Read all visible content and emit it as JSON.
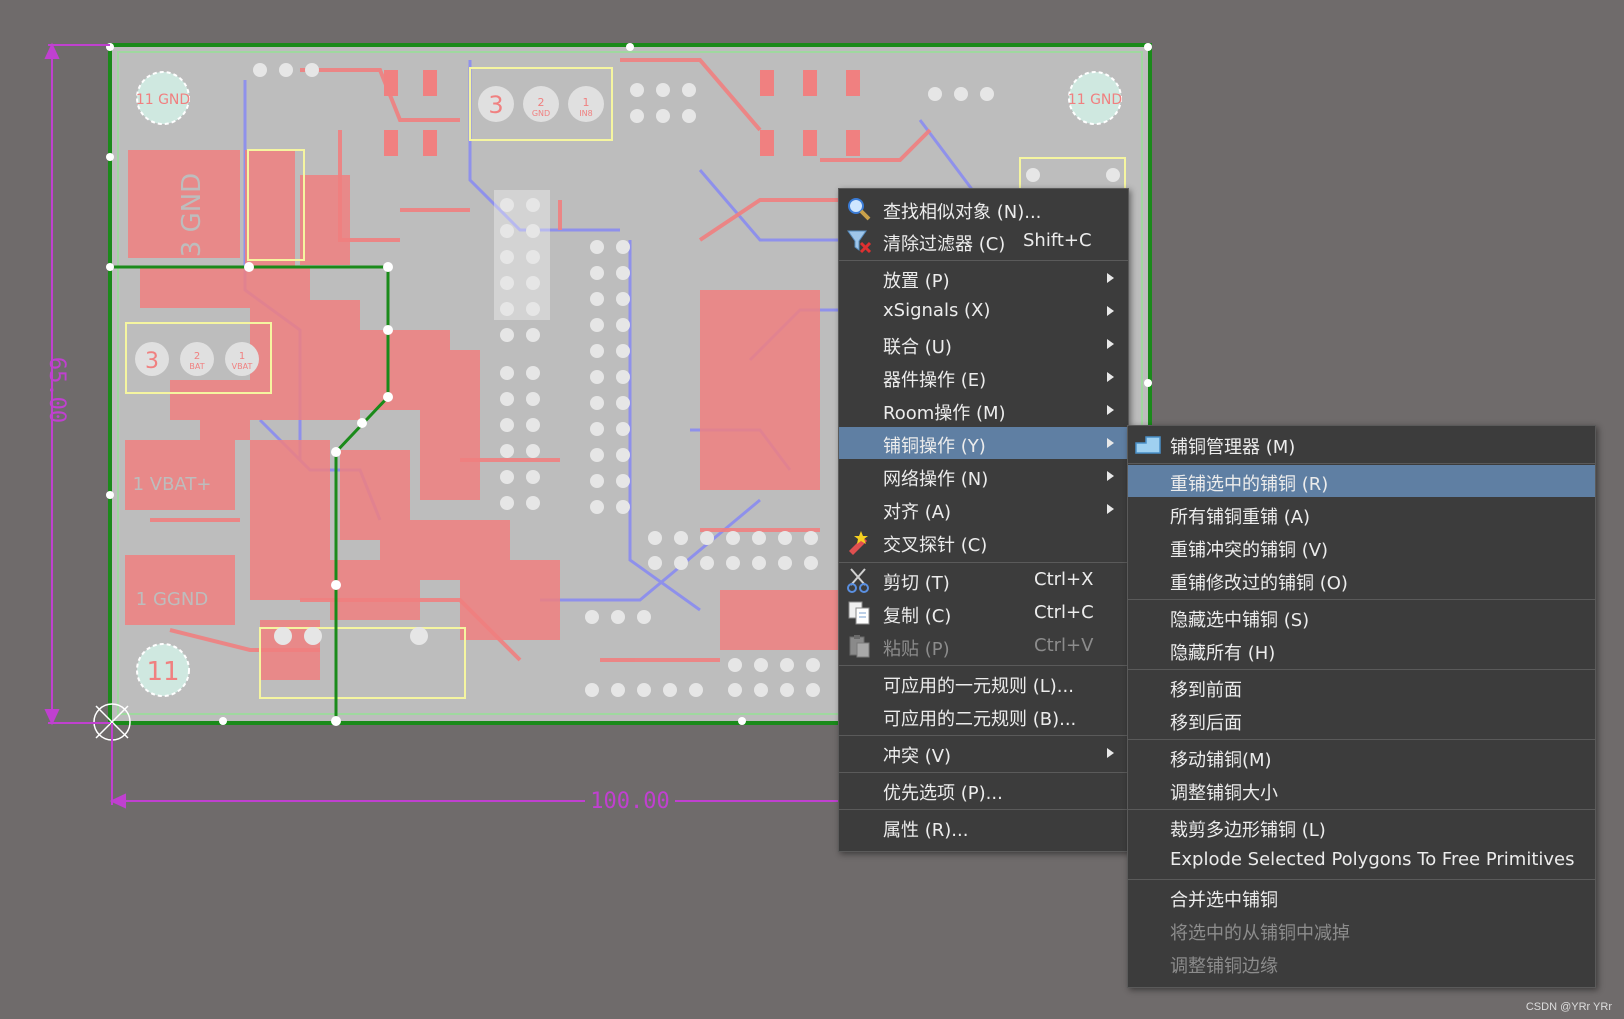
{
  "colors": {
    "background": "#6f6b6b",
    "board": "#bdbdbd",
    "copper_top": "#f08080",
    "copper_bottom": "#8a8cf0",
    "silkscreen": "#f5f5a0",
    "board_outline": "#1a8a1a",
    "dimension": "#c040d0",
    "menu_bg": "#3c3c3c",
    "menu_highlight": "#5f7fa3"
  },
  "pcb": {
    "dimension_vertical": "65.00",
    "dimension_horizontal": "100.00",
    "mounting_holes": [
      "11 GND",
      "11 GND",
      "11"
    ],
    "connectors": [
      {
        "pins": [
          "3",
          "2",
          "1"
        ],
        "labels": [
          "",
          "GND",
          "IN8"
        ]
      },
      {
        "pins": [
          "3",
          "2",
          "1"
        ],
        "labels": [
          "",
          "BAT",
          "VBAT"
        ]
      }
    ],
    "pads": [
      "3 GND",
      "1 VBAT+",
      "1 GGND"
    ]
  },
  "context_menu": {
    "items": [
      {
        "label": "查找相似对象 (N)...",
        "icon": "search-icon"
      },
      {
        "label": "清除过滤器 (C)",
        "shortcut": "Shift+C",
        "icon": "clear-filter-icon"
      },
      {
        "label": "放置 (P)",
        "submenu": true
      },
      {
        "label": "xSignals (X)",
        "submenu": true
      },
      {
        "label": "联合 (U)",
        "submenu": true
      },
      {
        "label": "器件操作 (E)",
        "submenu": true
      },
      {
        "label": "Room操作 (M)",
        "submenu": true
      },
      {
        "label": "铺铜操作 (Y)",
        "submenu": true,
        "selected": true
      },
      {
        "label": "网络操作 (N)",
        "submenu": true
      },
      {
        "label": "对齐 (A)",
        "submenu": true
      },
      {
        "label": "交叉探针 (C)",
        "icon": "cross-probe-icon"
      },
      {
        "label": "剪切 (T)",
        "shortcut": "Ctrl+X",
        "icon": "scissors-icon"
      },
      {
        "label": "复制 (C)",
        "shortcut": "Ctrl+C",
        "icon": "copy-icon"
      },
      {
        "label": "粘贴 (P)",
        "shortcut": "Ctrl+V",
        "icon": "paste-icon",
        "disabled": true
      },
      {
        "label": "可应用的一元规则 (L)..."
      },
      {
        "label": "可应用的二元规则 (B)..."
      },
      {
        "label": "冲突 (V)",
        "submenu": true
      },
      {
        "label": "优先选项 (P)..."
      },
      {
        "label": "属性 (R)..."
      }
    ]
  },
  "submenu": {
    "items": [
      {
        "label": "铺铜管理器 (M)",
        "icon": "polygon-manager-icon"
      },
      {
        "label": "重铺选中的铺铜 (R)",
        "selected": true
      },
      {
        "label": "所有铺铜重铺 (A)"
      },
      {
        "label": "重铺冲突的铺铜 (V)"
      },
      {
        "label": "重铺修改过的铺铜 (O)"
      },
      {
        "label": "隐藏选中铺铜 (S)"
      },
      {
        "label": "隐藏所有 (H)"
      },
      {
        "label": "移到前面"
      },
      {
        "label": "移到后面"
      },
      {
        "label": "移动铺铜(M)"
      },
      {
        "label": "调整铺铜大小"
      },
      {
        "label": "裁剪多边形铺铜 (L)"
      },
      {
        "label": "Explode Selected Polygons To Free Primitives"
      },
      {
        "label": "合并选中铺铜"
      },
      {
        "label": "将选中的从铺铜中减掉",
        "disabled": true
      },
      {
        "label": "调整铺铜边缘",
        "disabled": true
      }
    ]
  },
  "watermark": "CSDN @YRr YRr"
}
